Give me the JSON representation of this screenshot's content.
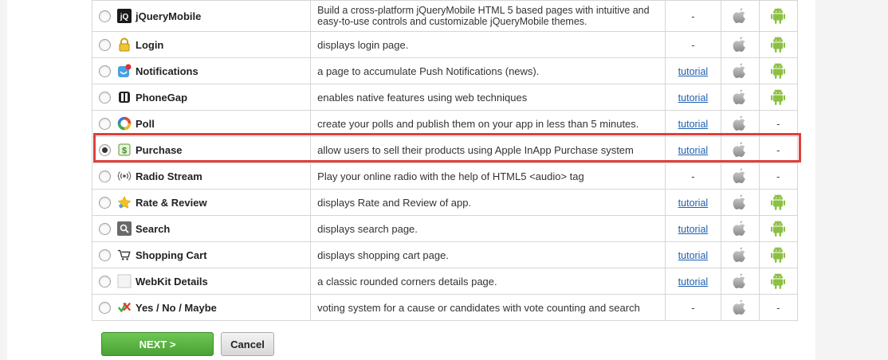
{
  "features": [
    {
      "name": "jQueryMobile",
      "icon": "jquerymobile-icon",
      "description": "Build a cross-platform jQueryMobile HTML 5 based pages with intuitive and easy-to-use controls and customizable jQueryMobile themes.",
      "tutorial": "-",
      "ios": "apple",
      "android": "android",
      "selected": false
    },
    {
      "name": "Login",
      "icon": "lock-icon",
      "description": "displays login page.",
      "tutorial": "-",
      "ios": "apple",
      "android": "android",
      "selected": false
    },
    {
      "name": "Notifications",
      "icon": "notifications-icon",
      "description": "a page to accumulate Push Notifications (news).",
      "tutorial": "tutorial",
      "ios": "apple",
      "android": "android",
      "selected": false
    },
    {
      "name": "PhoneGap",
      "icon": "phonegap-icon",
      "description": "enables native features using web techniques",
      "tutorial": "tutorial",
      "ios": "apple",
      "android": "android",
      "selected": false
    },
    {
      "name": "Poll",
      "icon": "poll-icon",
      "description": "create your polls and publish them on your app in less than 5 minutes.",
      "tutorial": "tutorial",
      "ios": "apple",
      "android": "-",
      "selected": false
    },
    {
      "name": "Purchase",
      "icon": "purchase-icon",
      "description": "allow users to sell their products using Apple InApp Purchase system",
      "tutorial": "tutorial",
      "ios": "apple",
      "android": "-",
      "selected": true
    },
    {
      "name": "Radio Stream",
      "icon": "radio-stream-icon",
      "description": "Play your online radio with the help of HTML5 <audio> tag",
      "tutorial": "-",
      "ios": "apple",
      "android": "-",
      "selected": false
    },
    {
      "name": "Rate & Review",
      "icon": "star-icon",
      "description": "displays Rate and Review of app.",
      "tutorial": "tutorial",
      "ios": "apple",
      "android": "android",
      "selected": false
    },
    {
      "name": "Search",
      "icon": "search-icon",
      "description": "displays search page.",
      "tutorial": "tutorial",
      "ios": "apple",
      "android": "android",
      "selected": false
    },
    {
      "name": "Shopping Cart",
      "icon": "shopping-cart-icon",
      "description": "displays shopping cart page.",
      "tutorial": "tutorial",
      "ios": "apple",
      "android": "android",
      "selected": false
    },
    {
      "name": "WebKit Details",
      "icon": "webkit-details-icon",
      "description": "a classic rounded corners details page.",
      "tutorial": "tutorial",
      "ios": "apple",
      "android": "android",
      "selected": false
    },
    {
      "name": "Yes / No / Maybe",
      "icon": "yes-no-maybe-icon",
      "description": "voting system for a cause or candidates with vote counting and search",
      "tutorial": "-",
      "ios": "apple",
      "android": "-",
      "selected": false
    }
  ],
  "buttons": {
    "next": "NEXT >",
    "cancel": "Cancel"
  },
  "colors": {
    "highlight": "#e0403a",
    "next_button": "#5ab244",
    "link": "#2060b0",
    "android_green": "#8cc043"
  }
}
